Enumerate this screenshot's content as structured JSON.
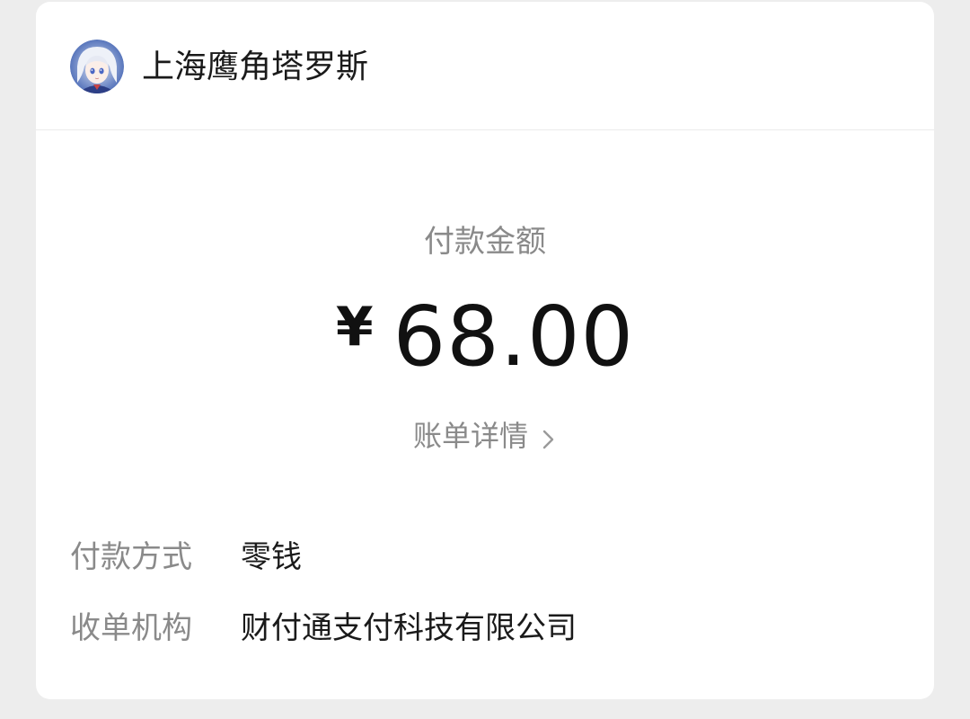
{
  "merchant": {
    "name": "上海鹰角塔罗斯",
    "avatar_icon": "anime-character-avatar"
  },
  "payment": {
    "amount_label": "付款金额",
    "currency_symbol": "¥",
    "amount": "68.00",
    "bill_detail_label": "账单详情"
  },
  "details": [
    {
      "label": "付款方式",
      "value": "零钱"
    },
    {
      "label": "收单机构",
      "value": "财付通支付科技有限公司"
    }
  ],
  "colors": {
    "background": "#ededed",
    "card": "#ffffff",
    "primary_text": "#111111",
    "secondary_text": "#8a8a8a"
  }
}
